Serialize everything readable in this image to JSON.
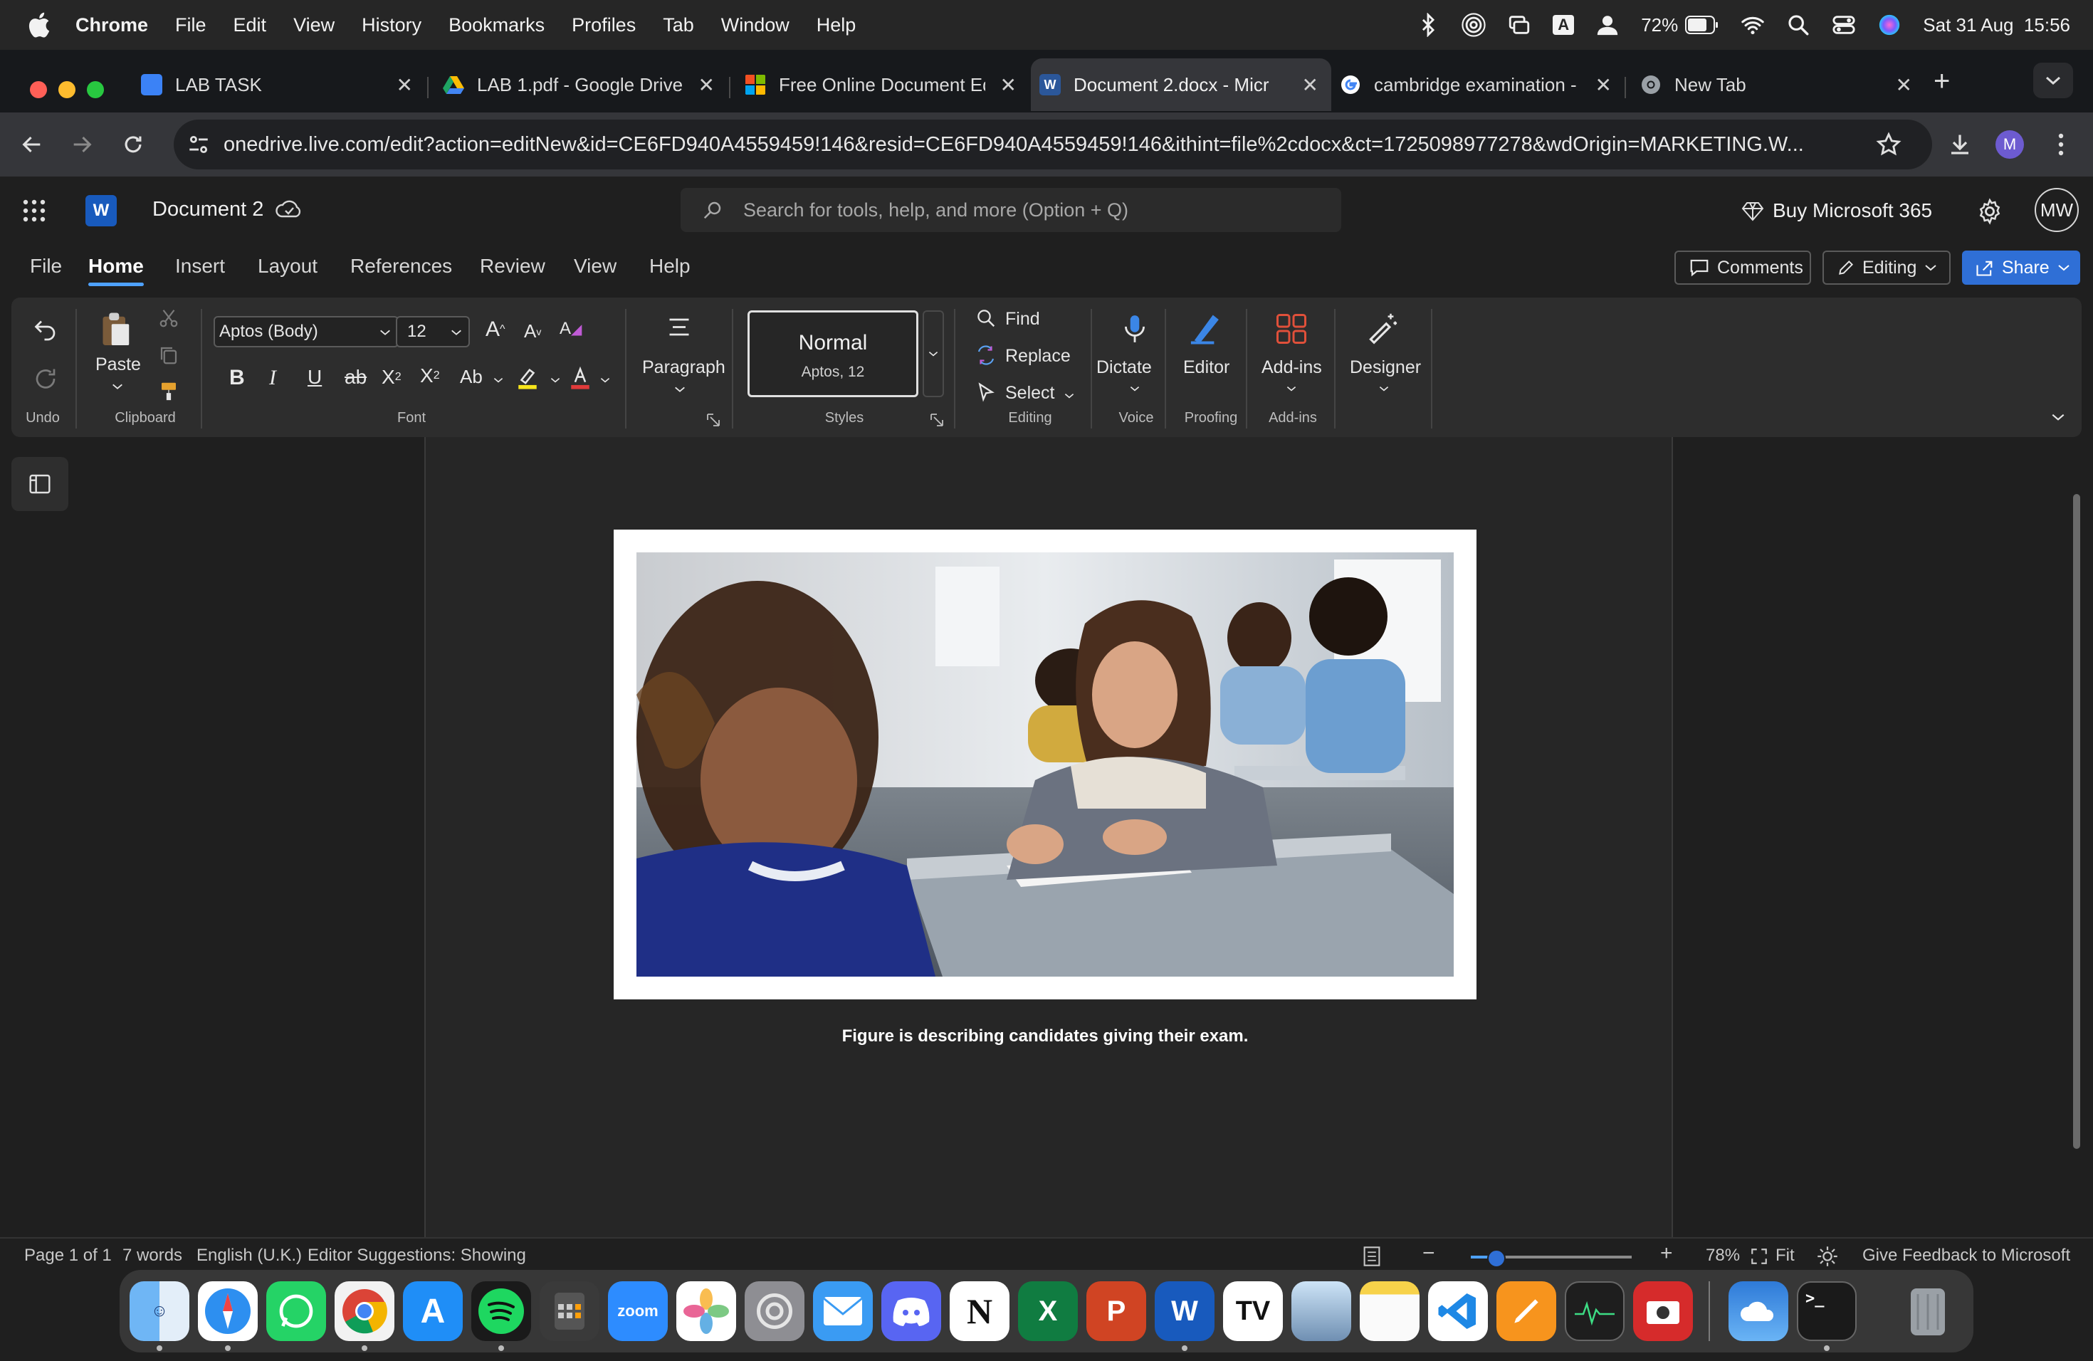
{
  "macos_menubar": {
    "app_name": "Chrome",
    "menus": [
      "File",
      "Edit",
      "View",
      "History",
      "Bookmarks",
      "Profiles",
      "Tab",
      "Window",
      "Help"
    ],
    "battery": "72%",
    "keyboard_input": "A",
    "datetime": "Sat 31 Aug  15:56"
  },
  "browser": {
    "tabs": [
      {
        "title": "LAB TASK",
        "favicon_color": "#3b82f6"
      },
      {
        "title": "LAB 1.pdf - Google Drive",
        "favicon_color": "#fbbc04"
      },
      {
        "title": "Free Online Document Ed",
        "favicon_color": "#f25022"
      },
      {
        "title": "Document 2.docx - Micr",
        "favicon_color": "#2b579a",
        "active": true
      },
      {
        "title": "cambridge examination -",
        "favicon_color": "#4285f4"
      },
      {
        "title": "New Tab",
        "favicon_color": "#9aa0a6"
      }
    ],
    "new_tab_symbol": "+",
    "url": "onedrive.live.com/edit?action=editNew&id=CE6FD940A4559459!146&resid=CE6FD940A4559459!146&ithint=file%2cdocx&ct=1725098977278&wdOrigin=MARKETING.W...",
    "profile_initial": "M"
  },
  "word": {
    "doc_title": "Document 2",
    "search_placeholder": "Search for tools, help, and more (Option + Q)",
    "buy_label": "Buy Microsoft 365",
    "user_initials": "MW",
    "ribbon_tabs": [
      "File",
      "Home",
      "Insert",
      "Layout",
      "References",
      "Review",
      "View",
      "Help"
    ],
    "active_tab": "Home",
    "comments_label": "Comments",
    "editing_label": "Editing",
    "share_label": "Share",
    "groups": {
      "undo": "Undo",
      "clipboard": "Clipboard",
      "paste": "Paste",
      "font": "Font",
      "font_name": "Aptos (Body)",
      "font_size": "12",
      "paragraph": "Paragraph",
      "style_name": "Normal",
      "style_detail": "Aptos, 12",
      "styles": "Styles",
      "find": "Find",
      "replace": "Replace",
      "select": "Select",
      "editing": "Editing",
      "dictate": "Dictate",
      "voice": "Voice",
      "editor": "Editor",
      "proofing": "Proofing",
      "addins": "Add-ins",
      "addins_group": "Add-ins",
      "designer": "Designer"
    },
    "caption": "Figure is describing candidates giving their exam.",
    "status": {
      "page": "Page 1 of 1",
      "words": "7 words",
      "language": "English (U.K.)",
      "editor_suggestions": "Editor Suggestions: Showing",
      "zoom": "78%",
      "fit": "Fit",
      "feedback": "Give Feedback to Microsoft",
      "zoom_level": 0.15
    }
  },
  "dock_apps": [
    "Finder",
    "Safari",
    "WhatsApp",
    "Chrome",
    "App Store",
    "Spotify",
    "Calculator",
    "Zoom",
    "Photos",
    "System Settings",
    "Mail",
    "Discord",
    "Notion",
    "Excel",
    "PowerPoint",
    "Word",
    "TradingView",
    "Preview",
    "Notes",
    "VS Code",
    "Pages",
    "Activity Monitor",
    "Photo Booth",
    "Weather",
    "Terminal",
    "Trash"
  ],
  "dock_labels": {
    "zoom_app": "zoom"
  }
}
